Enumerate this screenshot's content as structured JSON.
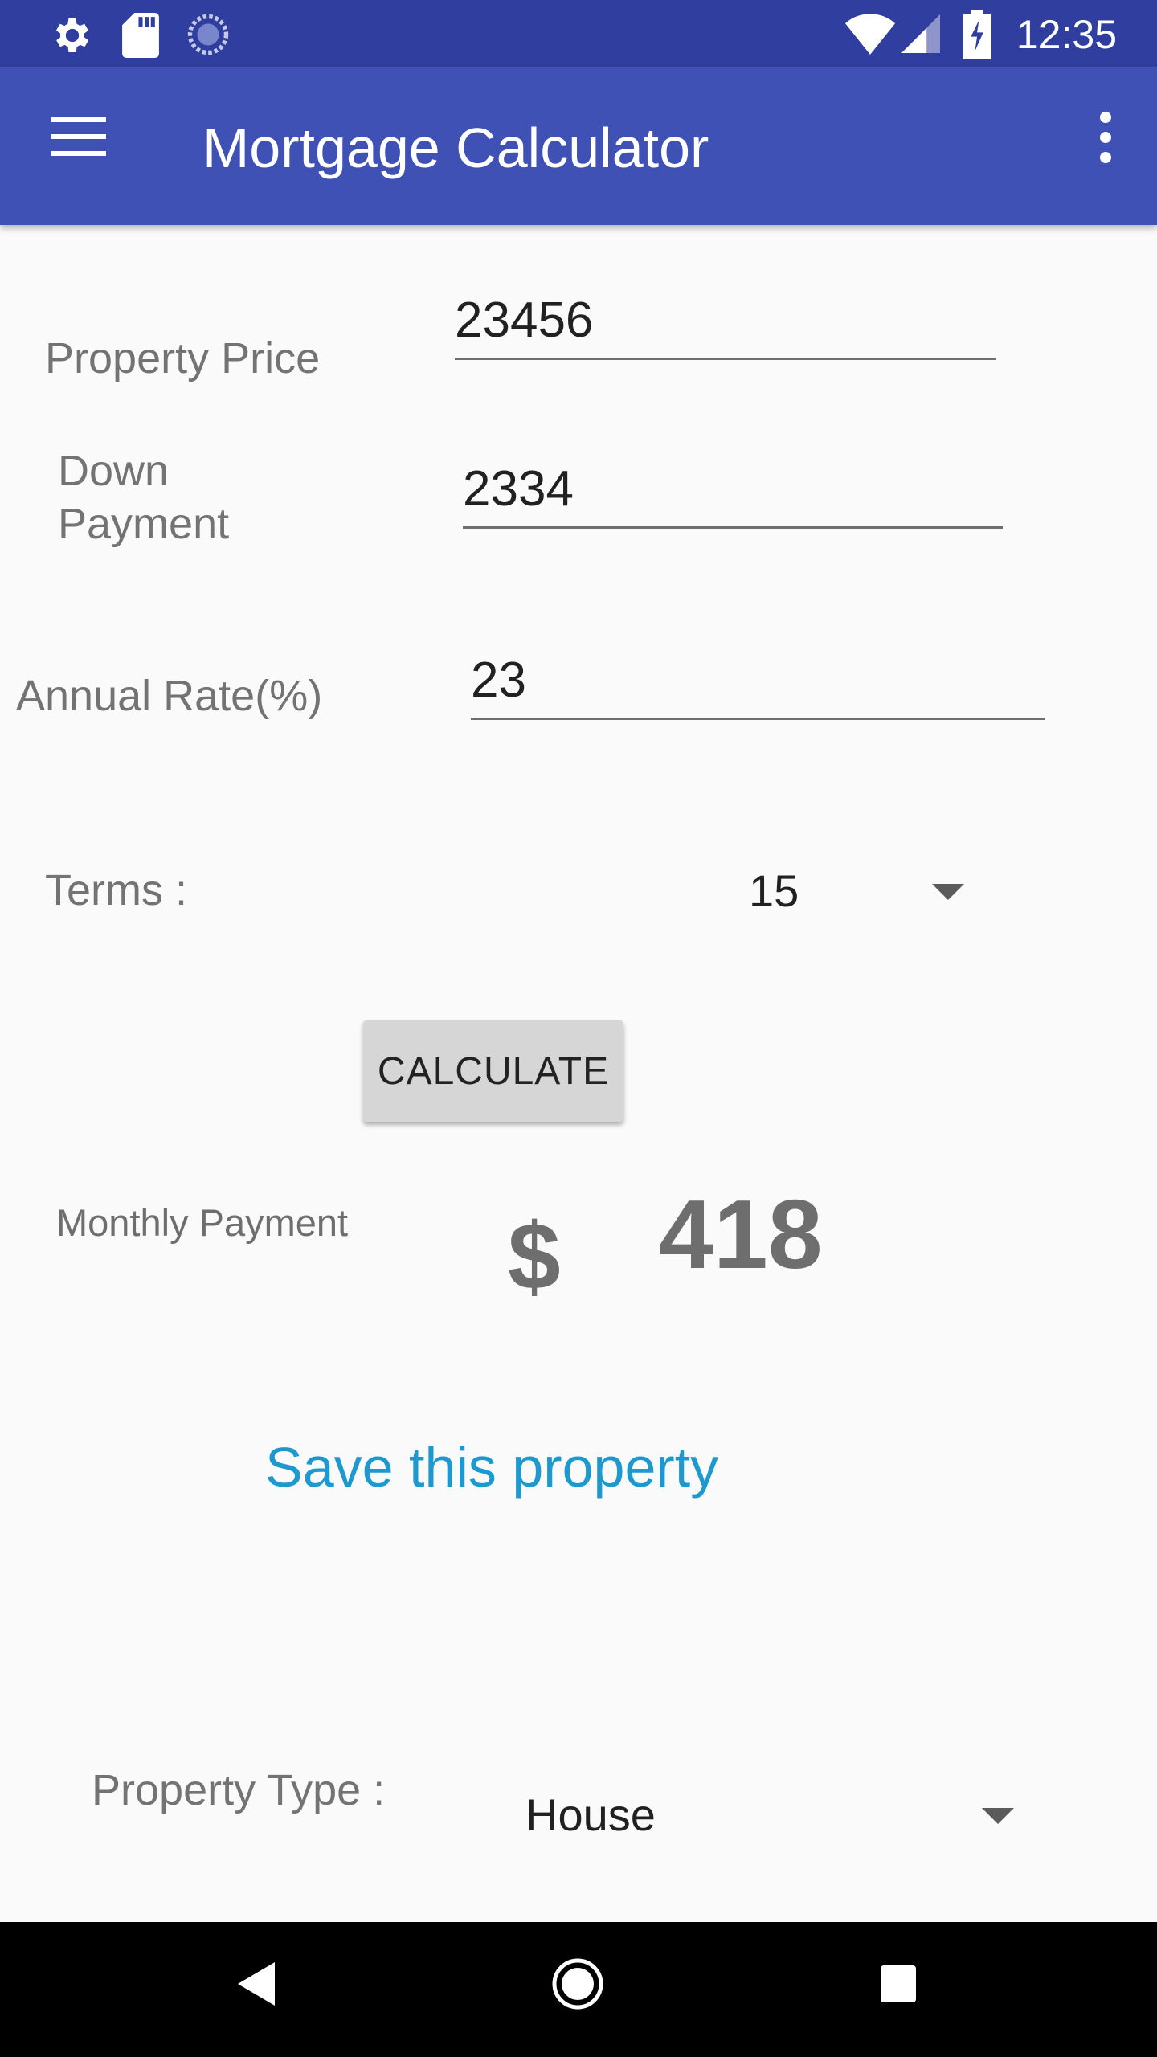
{
  "status_bar": {
    "time": "12:35",
    "icons": [
      "settings-icon",
      "sd-card-icon",
      "sync-icon",
      "wifi-icon",
      "signal-icon",
      "battery-charging-icon"
    ]
  },
  "app_bar": {
    "title": "Mortgage Calculator",
    "icons": [
      "menu-icon",
      "more-vert-icon"
    ]
  },
  "form": {
    "property_price": {
      "label": "Property Price",
      "value": "23456"
    },
    "down_payment": {
      "label_line1": "Down",
      "label_line2": "Payment",
      "value": "2334"
    },
    "annual_rate": {
      "label": "Annual Rate(%)",
      "value": "23"
    },
    "terms": {
      "label": "Terms :",
      "selected": "15"
    }
  },
  "calculate_button": "CALCULATE",
  "result": {
    "label": "Monthly Payment",
    "currency": "$",
    "amount": "418"
  },
  "save_link": "Save this property",
  "property_type": {
    "label": "Property Type :",
    "selected": "House"
  },
  "nav_bar": {
    "icons": [
      "back-icon",
      "home-icon",
      "recents-icon"
    ]
  },
  "colors": {
    "status_bar": "#303f9f",
    "app_bar": "#3f51b5",
    "link": "#1e99cf",
    "background": "#fafafa"
  }
}
